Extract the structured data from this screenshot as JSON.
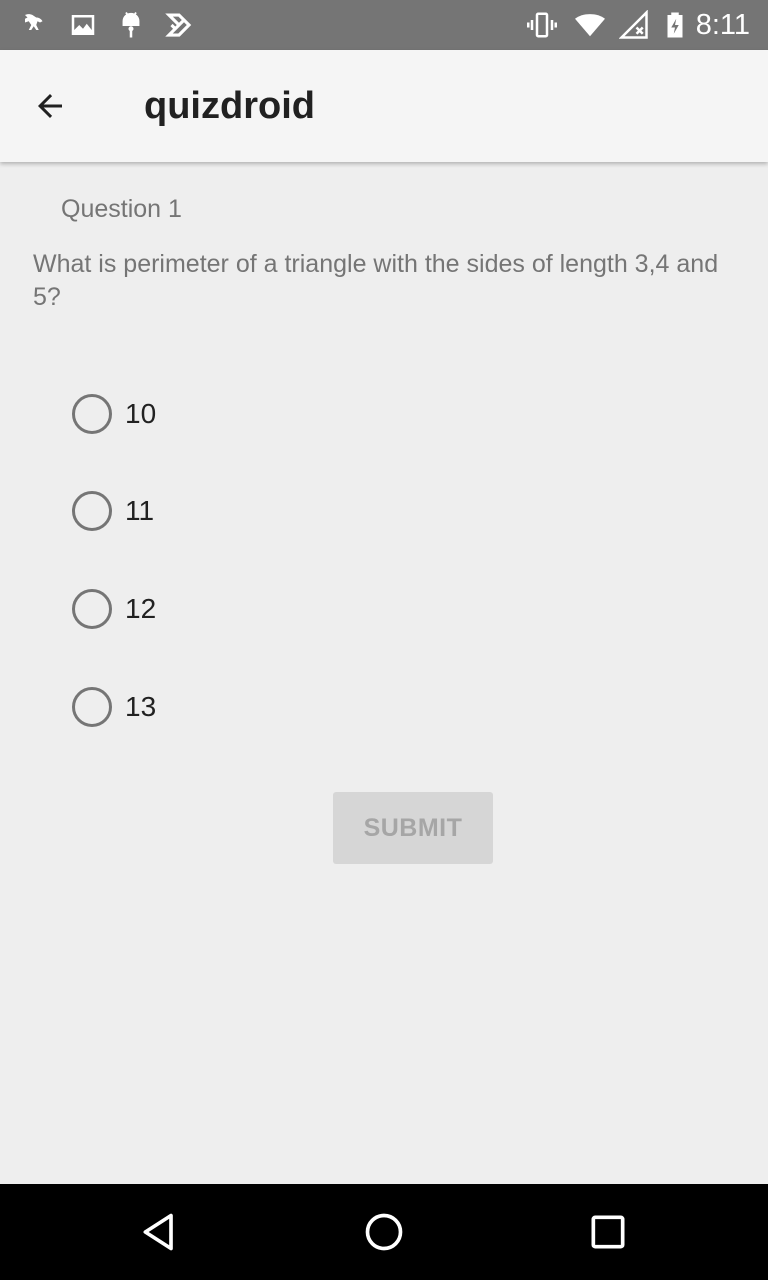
{
  "status_bar": {
    "time": "8:11",
    "left_icons": [
      "kangaroo-app-icon",
      "image-icon",
      "android-icon",
      "checkmark-app-icon"
    ],
    "right_icons": [
      "vibrate-icon",
      "wifi-icon",
      "no-signal-icon",
      "battery-charging-icon"
    ]
  },
  "app_bar": {
    "title": "quizdroid",
    "back_icon": "arrow-back-icon"
  },
  "question": {
    "label": "Question 1",
    "text": "What is perimeter of a triangle with the sides of length 3,4 and 5?"
  },
  "options": [
    {
      "label": "10",
      "selected": false
    },
    {
      "label": "11",
      "selected": false
    },
    {
      "label": "12",
      "selected": false
    },
    {
      "label": "13",
      "selected": false
    }
  ],
  "submit": {
    "label": "SUBMIT",
    "enabled": false
  },
  "nav_bar": {
    "icons": [
      "back-triangle-icon",
      "home-circle-icon",
      "recents-square-icon"
    ]
  },
  "colors": {
    "background": "#eeeeee",
    "app_bar": "#f5f5f5",
    "status_bar": "#757575",
    "secondary_text": "#757575",
    "primary_text": "#212121",
    "button_disabled": "#d6d6d6"
  }
}
